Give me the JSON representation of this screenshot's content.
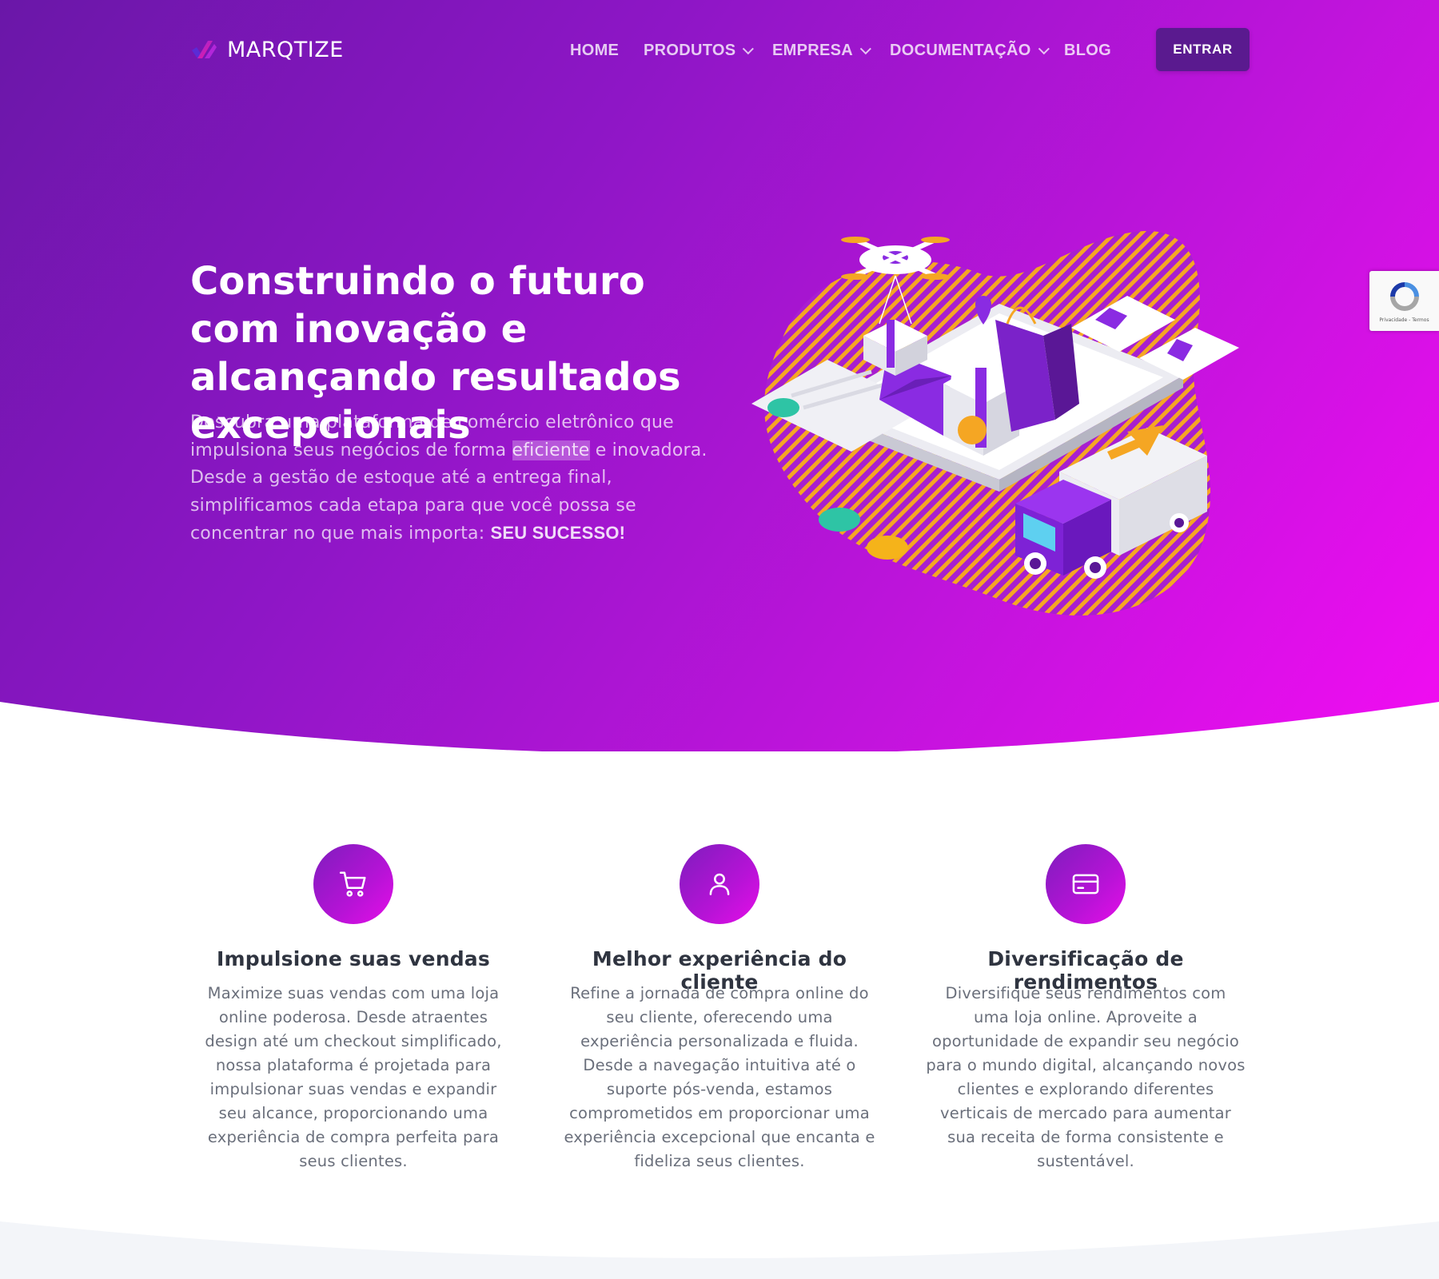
{
  "nav": {
    "brand": "MARQTIZE",
    "items": [
      {
        "label": "HOME",
        "dropdown": false
      },
      {
        "label": "PRODUTOS",
        "dropdown": true
      },
      {
        "label": "EMPRESA",
        "dropdown": true
      },
      {
        "label": "DOCUMENTAÇÃO",
        "dropdown": true
      },
      {
        "label": "BLOG",
        "dropdown": false
      }
    ],
    "login_label": "ENTRAR"
  },
  "hero": {
    "title": "Construindo o futuro com inovação e alcançando resultados excepcionais",
    "desc_before": "Descubra uma plataforma de comércio eletrônico que impulsiona seus negócios de forma ",
    "desc_highlight": "eficiente",
    "desc_after": " e inovadora. Desde a gestão de estoque até a entrega final, simplificamos cada etapa para que você possa se concentrar no que mais importa: ",
    "desc_strong": "SEU SUCESSO!"
  },
  "recaptcha": {
    "text": "Privacidade - Termos"
  },
  "features": [
    {
      "icon": "cart-icon",
      "title": "Impulsione suas vendas",
      "text": "Maximize suas vendas com uma loja online poderosa. Desde atraentes design até um checkout simplificado, nossa plataforma é projetada para impulsionar suas vendas e expandir seu alcance, proporcionando uma experiência de compra perfeita para seus clientes."
    },
    {
      "icon": "user-icon",
      "title": "Melhor experiência do cliente",
      "text": "Refine a jornada de compra online do seu cliente, oferecendo uma experiência personalizada e fluida. Desde a navegação intuitiva até o suporte pós-venda, estamos comprometidos em proporcionar uma experiência excepcional que encanta e fideliza seus clientes."
    },
    {
      "icon": "credit-card-icon",
      "title": "Diversificação de rendimentos",
      "text": "Diversifique seus rendimentos com uma loja online. Aproveite a oportunidade de expandir seu negócio para o mundo digital, alcançando novos clientes e explorando diferentes verticais de mercado para aumentar sua receita de forma consistente e sustentável."
    }
  ],
  "colors": {
    "gradient_start": "#6a17a8",
    "gradient_end": "#f20cf2",
    "button": "#5a1a8f",
    "accent_orange": "#f5a623",
    "heading": "#2f3440",
    "body_text": "#6a6f7b"
  }
}
